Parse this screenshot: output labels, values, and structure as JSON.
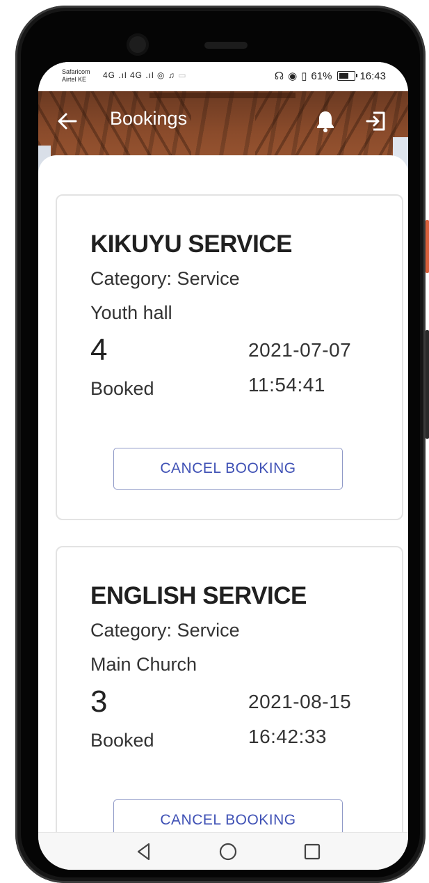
{
  "status_bar": {
    "carrier_1": "Safaricom",
    "carrier_2": "Airtel KE",
    "network_icons": "4G .ıl 4G .ıl",
    "battery_text": "61%",
    "battery_level": 0.61,
    "time": "16:43"
  },
  "app_bar": {
    "title": "Bookings",
    "back_icon": "arrow-left-icon",
    "notification_icon": "bell-icon",
    "logout_icon": "logout-icon"
  },
  "bookings": [
    {
      "title": "KIKUYU SERVICE",
      "category": "Category: Service",
      "location": "Youth hall",
      "count": "4",
      "count_label": "Booked",
      "date": "2021-07-07",
      "time": "11:54:41",
      "cancel_label": "CANCEL BOOKING"
    },
    {
      "title": "ENGLISH SERVICE",
      "category": "Category: Service",
      "location": "Main Church",
      "count": "3",
      "count_label": "Booked",
      "date": "2021-08-15",
      "time": "16:42:33",
      "cancel_label": "CANCEL BOOKING"
    }
  ],
  "nav_bar": {
    "back_icon": "triangle-back-icon",
    "home_icon": "circle-home-icon",
    "recents_icon": "square-recents-icon"
  },
  "colors": {
    "accent": "#3f51b5",
    "button_border": "#8f99c7",
    "header_wood": "#8a4b2b"
  }
}
